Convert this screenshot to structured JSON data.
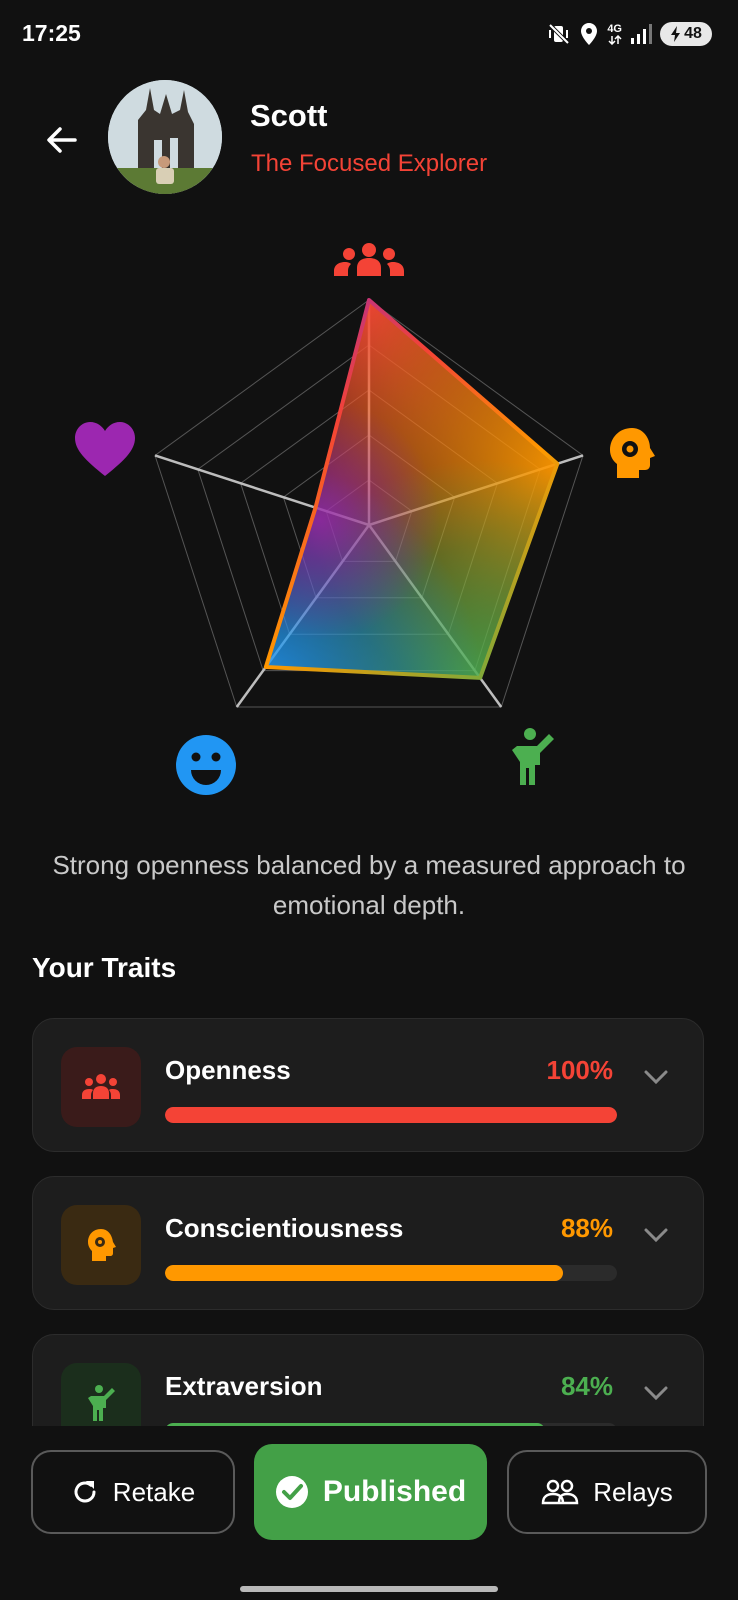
{
  "status_bar": {
    "time": "17:25",
    "network": "4G",
    "battery": "48",
    "icons": [
      "vibrate-mute-icon",
      "location-icon",
      "signal-icon",
      "battery-charging-icon"
    ]
  },
  "header": {
    "user_name": "Scott",
    "personality_type": "The Focused Explorer"
  },
  "radar": {
    "axes": [
      {
        "trait": "Openness",
        "icon": "people-icon",
        "color": "#f44336"
      },
      {
        "trait": "Conscientiousness",
        "icon": "head-gear-icon",
        "color": "#ff9800"
      },
      {
        "trait": "Extraversion",
        "icon": "person-waving-icon",
        "color": "#4caf50"
      },
      {
        "trait": "Agreeableness",
        "icon": "smiley-icon",
        "color": "#2196f3"
      },
      {
        "trait": "Neuroticism",
        "icon": "heart-icon",
        "color": "#9c27b0"
      }
    ],
    "values": [
      1.0,
      0.88,
      0.84,
      0.78,
      0.25
    ]
  },
  "summary": "Strong openness balanced by a measured approach to emotional depth.",
  "traits_heading": "Your Traits",
  "traits": [
    {
      "name": "Openness",
      "percent_label": "100%",
      "value": 1.0,
      "color": "#f44336",
      "icon": "people-icon"
    },
    {
      "name": "Conscientiousness",
      "percent_label": "88%",
      "value": 0.88,
      "color": "#ff9800",
      "icon": "head-gear-icon"
    },
    {
      "name": "Extraversion",
      "percent_label": "84%",
      "value": 0.84,
      "color": "#4caf50",
      "icon": "person-waving-icon"
    }
  ],
  "actions": {
    "retake": "Retake",
    "published": "Published",
    "relays": "Relays"
  }
}
